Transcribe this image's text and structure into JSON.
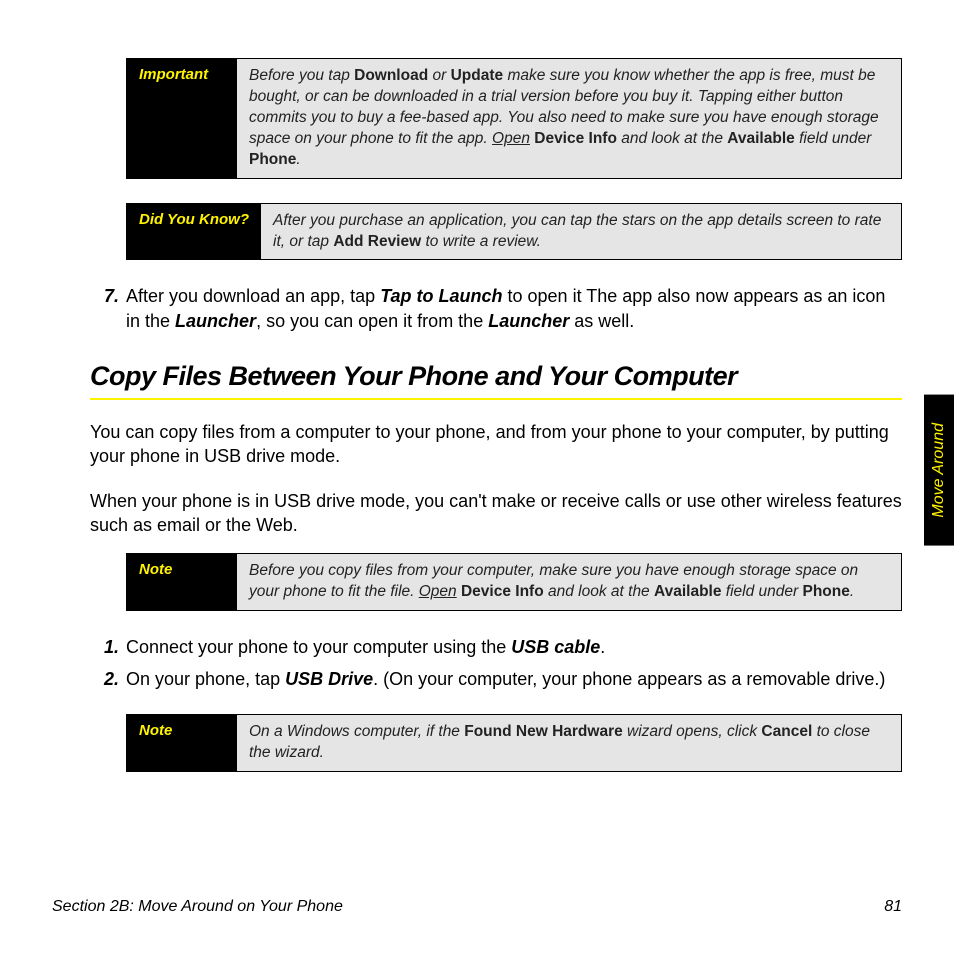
{
  "callouts": {
    "important": {
      "label": "Important",
      "html": "Before you tap <b>Download</b> or <b>Update</b> make sure you know whether the app is free, must be bought, or can be downloaded in a trial version before you buy it. Tapping either button commits you to buy a fee-based app. You also need to make sure you have enough storage space on your phone to fit the app. <u>Open</u> <b>Device Info</b> and look at the <b>Available</b> field under <b>Phone</b>."
    },
    "didyouknow": {
      "label": "Did You Know?",
      "html": "After you purchase an application, you can tap the stars on the app details screen to rate it, or tap <b>Add Review</b> to write a review."
    },
    "note1": {
      "label": "Note",
      "html": "Before you copy files from your computer, make sure you have enough storage space on your phone to fit the file. <u>Open</u> <b>Device Info</b> and look at the <b>Available</b> field under <b>Phone</b>."
    },
    "note2": {
      "label": "Note",
      "html": "On a Windows computer, if the <b>Found New Hardware</b> wizard opens, click <b>Cancel</b> to close the wizard."
    }
  },
  "step7": {
    "num": "7.",
    "html": "After you download an app, tap <span class=\"bi\">Tap to Launch</span> to open it The app also now appears as an icon in the <span class=\"bi\">Launcher</span>, so you can open it from the <span class=\"bi\">Launcher</span> as well."
  },
  "heading": "Copy Files Between Your Phone and Your Computer",
  "para1": "You can copy files from a computer to your phone, and from your phone to your computer, by putting your phone in USB drive mode.",
  "para2": "When your phone is in USB drive mode, you can't make or receive calls or use other wireless features such as email or the Web.",
  "usb_steps": [
    {
      "num": "1.",
      "html": "Connect your phone to your computer using the <span class=\"bi\">USB cable</span>."
    },
    {
      "num": "2.",
      "html": "On your phone, tap <span class=\"bi\">USB Drive</span>. (On your computer, your phone appears as a removable drive.)"
    }
  ],
  "side_tab": "Move Around",
  "footer_left": "Section 2B: Move Around on Your Phone",
  "footer_right": "81"
}
